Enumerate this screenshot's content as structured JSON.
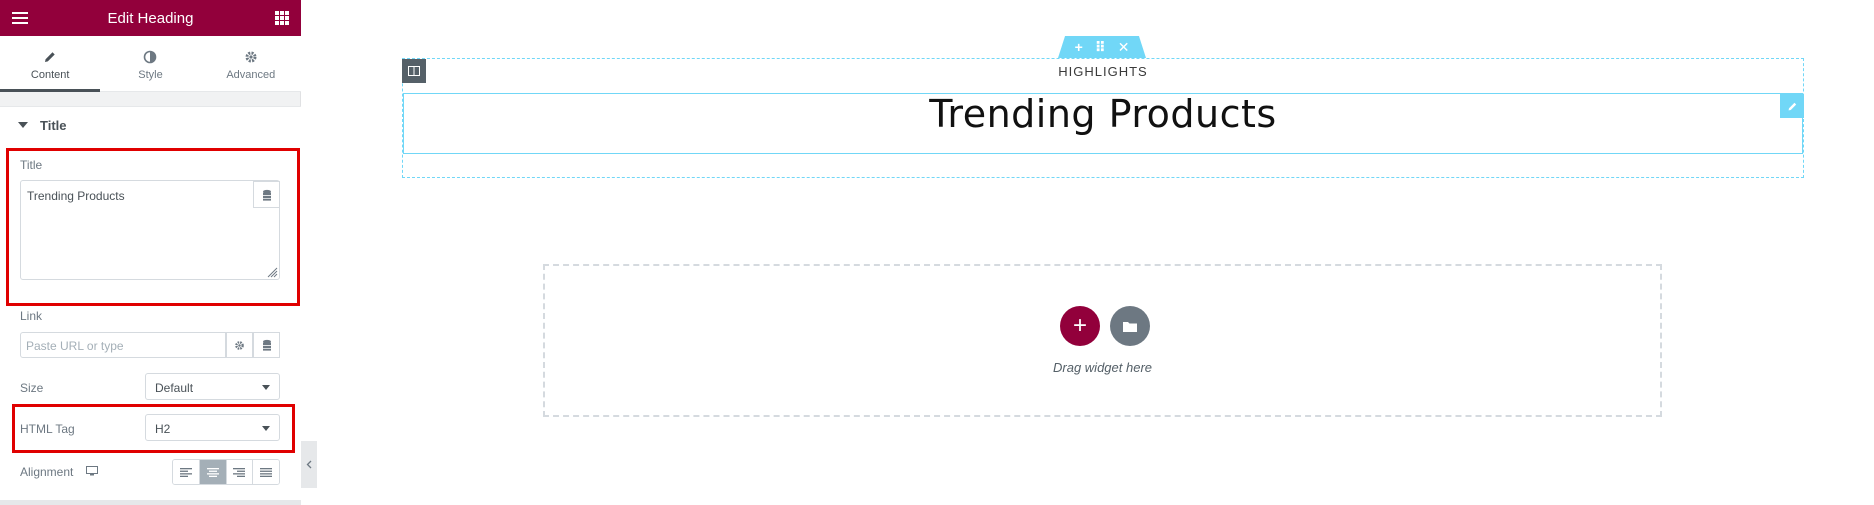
{
  "panel": {
    "header_title": "Edit Heading",
    "tabs": [
      {
        "label": "Content",
        "icon": "pencil-icon",
        "active": true
      },
      {
        "label": "Style",
        "icon": "contrast-icon",
        "active": false
      },
      {
        "label": "Advanced",
        "icon": "gear-icon",
        "active": false
      }
    ],
    "section_title": "Title",
    "controls": {
      "title_label": "Title",
      "title_value": "Trending Products",
      "link_label": "Link",
      "link_placeholder": "Paste URL or type",
      "size_label": "Size",
      "size_value": "Default",
      "html_tag_label": "HTML Tag",
      "html_tag_value": "H2",
      "alignment_label": "Alignment",
      "alignment_options": [
        "left",
        "center",
        "right",
        "justify"
      ],
      "alignment_selected": "center"
    }
  },
  "canvas": {
    "subheading": "HIGHLIGHTS",
    "heading": "Trending Products",
    "dropzone_text": "Drag widget here",
    "section_handle": {
      "add": "+",
      "move": "⠿",
      "close": "✕"
    }
  },
  "colors": {
    "brand": "#92003b",
    "editor_accent": "#71d7f7",
    "highlight_annotation": "#e00000"
  }
}
